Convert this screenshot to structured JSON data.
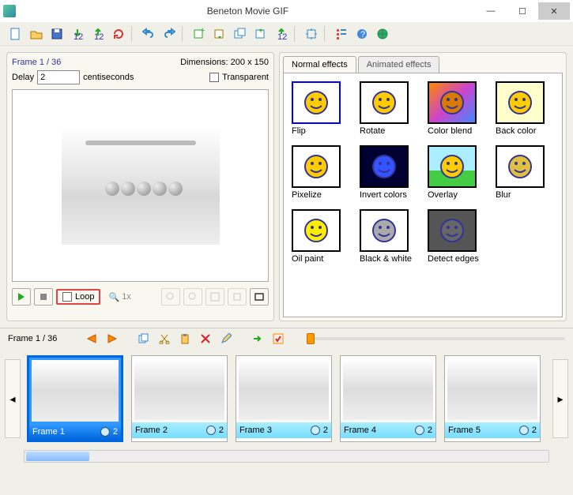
{
  "app": {
    "title": "Beneton Movie GIF"
  },
  "window": {
    "min": "—",
    "max": "☐",
    "close": "✕"
  },
  "toolbar_icons": [
    "new",
    "open",
    "save",
    "import",
    "export",
    "reload",
    "sep",
    "undo",
    "redo",
    "sep",
    "frame-add",
    "frame-insert",
    "frame-dup",
    "frame-move",
    "frame-renumber",
    "sep",
    "resize",
    "sep",
    "list",
    "help",
    "web"
  ],
  "preview": {
    "frame_label": "Frame 1 / 36",
    "dimensions": "Dimensions: 200 x 150",
    "delay_label": "Delay",
    "delay_value": "2",
    "delay_unit": "centiseconds",
    "transparent_label": "Transparent",
    "loop_label": "Loop",
    "zoom_label": "1x"
  },
  "effects": {
    "tab_normal": "Normal effects",
    "tab_animated": "Animated effects",
    "items": [
      {
        "name": "Flip",
        "bg": "#fff",
        "face": "#ffcc00"
      },
      {
        "name": "Rotate",
        "bg": "#fff",
        "face": "#ffcc00"
      },
      {
        "name": "Color blend",
        "bg": "linear-gradient(135deg,#f80,#c4c,#48f)",
        "face": "#d87a00"
      },
      {
        "name": "Back color",
        "bg": "#ffffcc",
        "face": "#ffcc00"
      },
      {
        "name": "Pixelize",
        "bg": "#fff",
        "face": "#ffcc00"
      },
      {
        "name": "Invert colors",
        "bg": "#000033",
        "face": "#3355ff"
      },
      {
        "name": "Overlay",
        "bg": "linear-gradient(#aef 60%,#4c4 60%)",
        "face": "#ffcc00"
      },
      {
        "name": "Blur",
        "bg": "#fff",
        "face": "#e0c040"
      },
      {
        "name": "Oil paint",
        "bg": "#fff",
        "face": "#ffee00"
      },
      {
        "name": "Black & white",
        "bg": "#fff",
        "face": "#aaaaaa"
      },
      {
        "name": "Detect edges",
        "bg": "#555",
        "face": "#666"
      }
    ]
  },
  "framebar": {
    "label": "Frame 1 / 36"
  },
  "frames": [
    {
      "label": "Frame 1",
      "delay": "2",
      "selected": true
    },
    {
      "label": "Frame 2",
      "delay": "2",
      "selected": false
    },
    {
      "label": "Frame 3",
      "delay": "2",
      "selected": false
    },
    {
      "label": "Frame 4",
      "delay": "2",
      "selected": false
    },
    {
      "label": "Frame 5",
      "delay": "2",
      "selected": false
    }
  ]
}
